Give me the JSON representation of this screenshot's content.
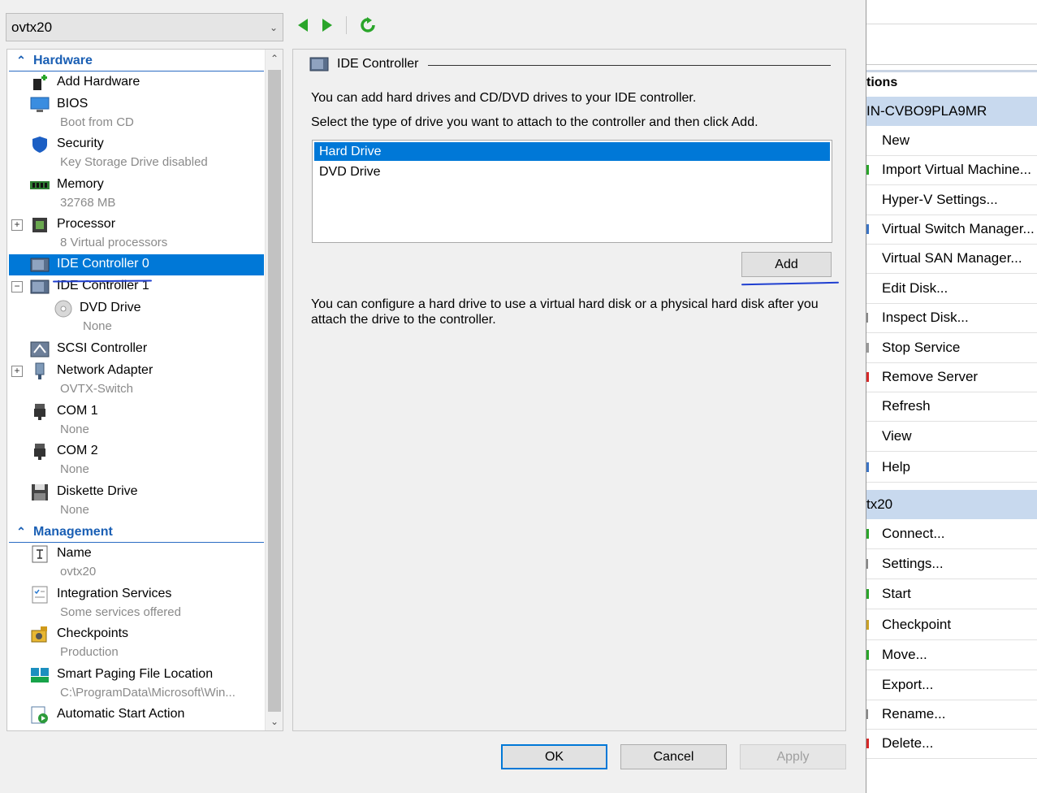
{
  "vm_selector": {
    "value": "ovtx20"
  },
  "tree": {
    "hardware_header": "Hardware",
    "management_header": "Management",
    "hardware_items": [
      {
        "label": "Add Hardware",
        "sub": ""
      },
      {
        "label": "BIOS",
        "sub": "Boot from CD"
      },
      {
        "label": "Security",
        "sub": "Key Storage Drive disabled"
      },
      {
        "label": "Memory",
        "sub": "32768 MB"
      },
      {
        "label": "Processor",
        "sub": "8 Virtual processors"
      },
      {
        "label": "IDE Controller 0",
        "sub": ""
      },
      {
        "label": "IDE Controller 1",
        "sub": ""
      },
      {
        "label": "DVD Drive",
        "sub": "None"
      },
      {
        "label": "SCSI Controller",
        "sub": ""
      },
      {
        "label": "Network Adapter",
        "sub": "OVTX-Switch"
      },
      {
        "label": "COM 1",
        "sub": "None"
      },
      {
        "label": "COM 2",
        "sub": "None"
      },
      {
        "label": "Diskette Drive",
        "sub": "None"
      }
    ],
    "management_items": [
      {
        "label": "Name",
        "sub": "ovtx20"
      },
      {
        "label": "Integration Services",
        "sub": "Some services offered"
      },
      {
        "label": "Checkpoints",
        "sub": "Production"
      },
      {
        "label": "Smart Paging File Location",
        "sub": "C:\\ProgramData\\Microsoft\\Win..."
      },
      {
        "label": "Automatic Start Action",
        "sub": ""
      }
    ]
  },
  "panel": {
    "group_title": "IDE Controller",
    "line1": "You can add hard drives and CD/DVD drives to your IDE controller.",
    "line2": "Select the type of drive you want to attach to the controller and then click Add.",
    "drive_options": [
      "Hard Drive",
      "DVD Drive"
    ],
    "selected_option": "Hard Drive",
    "add_label": "Add",
    "info": "You can configure a hard drive to use a virtual hard disk or a physical hard disk after you attach the drive to the controller."
  },
  "buttons": {
    "ok": "OK",
    "cancel": "Cancel",
    "apply": "Apply"
  },
  "actions": {
    "title": "tions",
    "server_group": "IN-CVBO9PLA9MR",
    "server_actions": [
      "New",
      "Import Virtual Machine...",
      "Hyper-V Settings...",
      "Virtual Switch Manager...",
      "Virtual SAN Manager...",
      "Edit Disk...",
      "Inspect Disk...",
      "Stop Service",
      "Remove Server",
      "Refresh",
      "View",
      "Help"
    ],
    "vm_group": "tx20",
    "vm_actions": [
      "Connect...",
      "Settings...",
      "Start",
      "Checkpoint",
      "Move...",
      "Export...",
      "Rename...",
      "Delete..."
    ]
  },
  "colors": {
    "selection": "#0078d7",
    "section_header": "#1a5fb4",
    "nav_arrow": "#2aa52a",
    "group_band": "#c8d9ee"
  }
}
